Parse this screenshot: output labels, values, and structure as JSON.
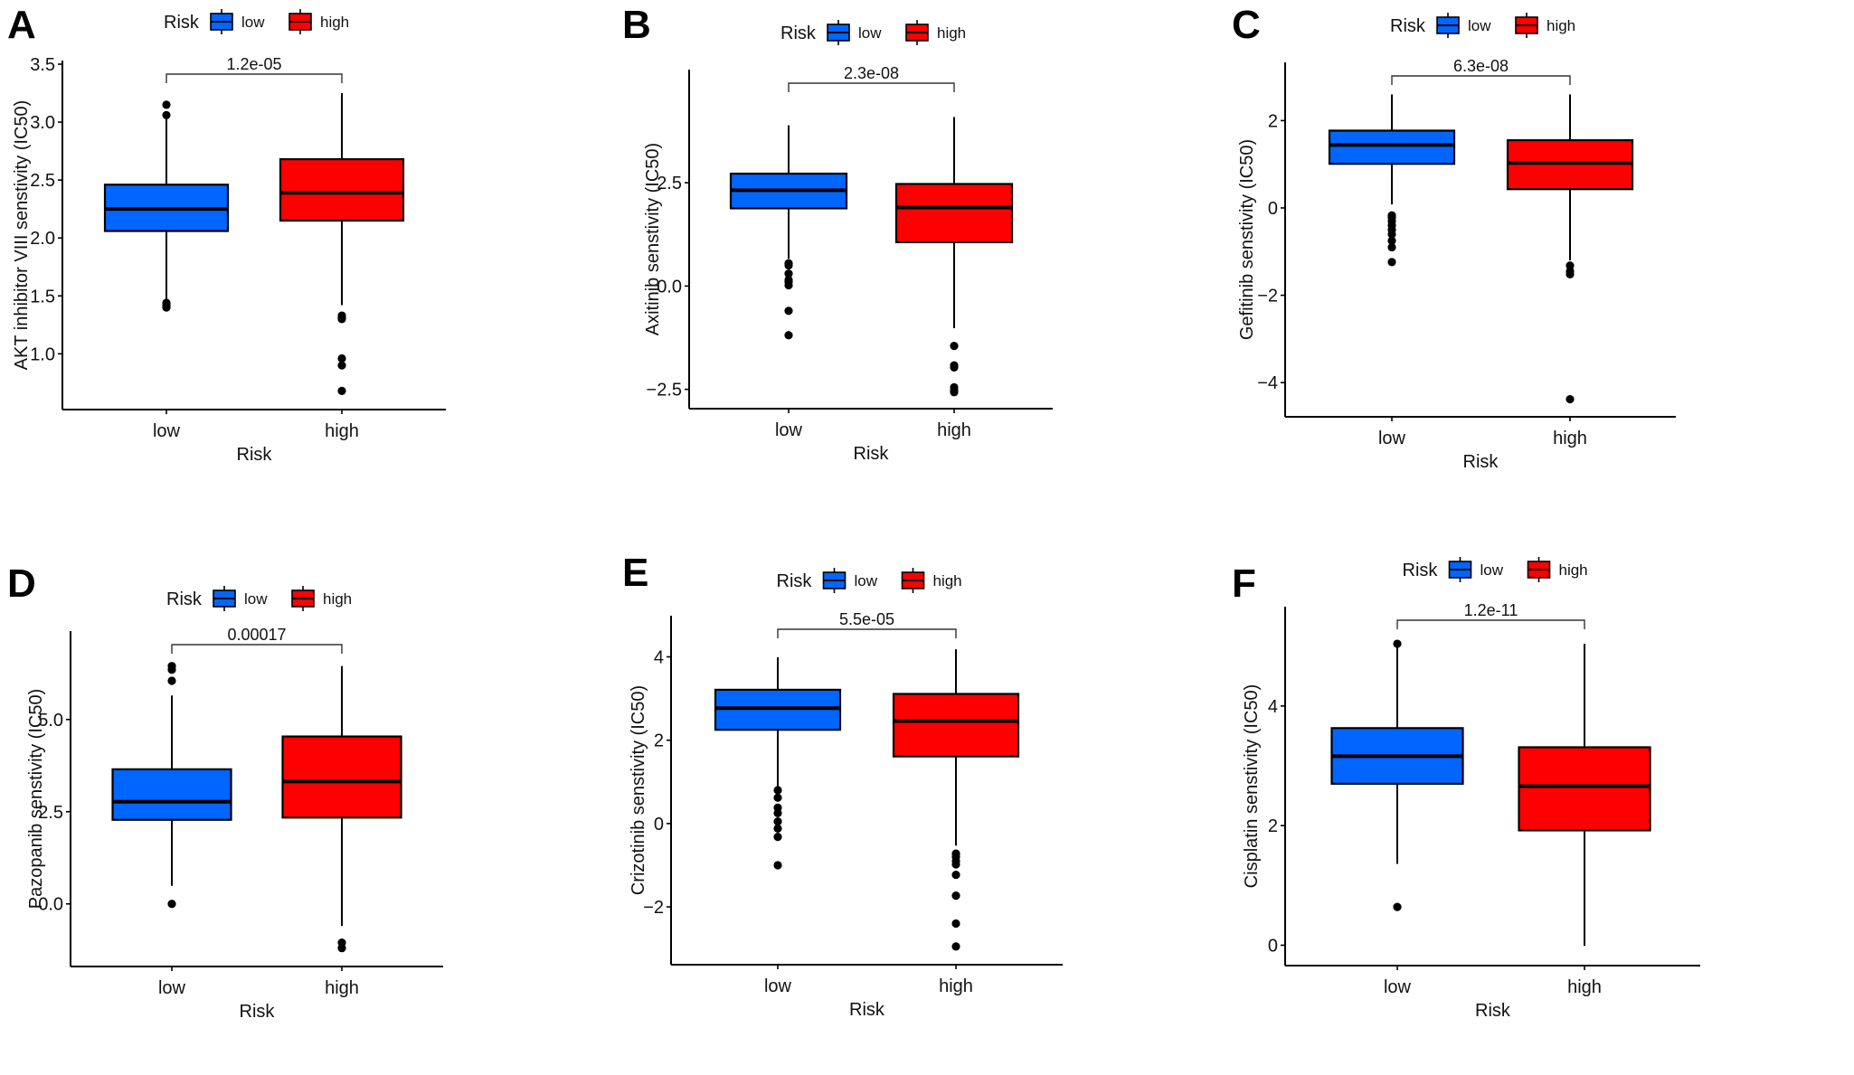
{
  "figure": {
    "colors": {
      "low": "#0066FF",
      "high": "#FF0000",
      "axis": "#000000"
    },
    "legend": {
      "title": "Risk",
      "items": [
        {
          "key": "low",
          "label": "low"
        },
        {
          "key": "high",
          "label": "high"
        }
      ]
    }
  },
  "chart_data": [
    {
      "panel": "A",
      "type": "boxplot",
      "title": "",
      "xlabel": "Risk",
      "ylabel": "AKT inhibitor VIII senstivity (IC50)",
      "categories": [
        "low",
        "high"
      ],
      "yticks": [
        "1.0",
        "1.5",
        "2.0",
        "2.5",
        "3.0",
        "3.5"
      ],
      "ylim": [
        0.55,
        3.5
      ],
      "p_value": "1.2e-05",
      "legend_position": "top",
      "series": [
        {
          "name": "low",
          "min": 1.46,
          "q1": 2.06,
          "median": 2.25,
          "q3": 2.46,
          "max": 3.04,
          "outliers": [
            3.15,
            3.06,
            1.44,
            1.42,
            1.4
          ]
        },
        {
          "name": "high",
          "min": 1.42,
          "q1": 2.15,
          "median": 2.39,
          "q3": 2.68,
          "max": 3.25,
          "outliers": [
            1.33,
            1.31,
            1.3,
            0.96,
            0.9,
            0.68
          ]
        }
      ]
    },
    {
      "panel": "B",
      "type": "boxplot",
      "title": "",
      "xlabel": "Risk",
      "ylabel": "Axitinib senstivity (IC50)",
      "categories": [
        "low",
        "high"
      ],
      "yticks": [
        "-2.5",
        "0.0",
        "2.5"
      ],
      "ylim": [
        -2.88,
        5.15
      ],
      "p_value": "2.3e-08",
      "legend_position": "top",
      "series": [
        {
          "name": "low",
          "min": 0.66,
          "q1": 1.88,
          "median": 2.32,
          "q3": 2.72,
          "max": 3.89,
          "outliers": [
            0.55,
            0.5,
            0.3,
            0.15,
            0.1,
            0.02,
            -0.6,
            -1.19
          ]
        },
        {
          "name": "high",
          "min": -1.02,
          "q1": 1.06,
          "median": 1.9,
          "q3": 2.47,
          "max": 4.09,
          "outliers": [
            -1.45,
            -1.92,
            -1.97,
            -2.45,
            -2.52,
            -2.57
          ]
        }
      ]
    },
    {
      "panel": "C",
      "type": "boxplot",
      "title": "",
      "xlabel": "Risk",
      "ylabel": "Gefitinib senstivity (IC50)",
      "categories": [
        "low",
        "high"
      ],
      "yticks": [
        "-4",
        "-2",
        "0",
        "2"
      ],
      "ylim": [
        -4.7,
        3.25
      ],
      "p_value": "6.3e-08",
      "legend_position": "top",
      "series": [
        {
          "name": "low",
          "min": 0.08,
          "q1": 1.01,
          "median": 1.44,
          "q3": 1.77,
          "max": 2.6,
          "outliers": [
            -0.17,
            -0.22,
            -0.3,
            -0.4,
            -0.5,
            -0.6,
            -0.75,
            -0.9,
            -1.24
          ]
        },
        {
          "name": "high",
          "min": -1.2,
          "q1": 0.43,
          "median": 1.03,
          "q3": 1.55,
          "max": 2.6,
          "outliers": [
            -1.32,
            -1.45,
            -1.52,
            -4.38
          ]
        }
      ]
    },
    {
      "panel": "D",
      "type": "boxplot",
      "title": "",
      "xlabel": "Risk",
      "ylabel": "Pazopanib senstivity (IC50)",
      "categories": [
        "low",
        "high"
      ],
      "yticks": [
        "0.0",
        "2.5",
        "5.0"
      ],
      "ylim": [
        -1.6,
        7.3
      ],
      "p_value": "0.00017",
      "legend_position": "top",
      "series": [
        {
          "name": "low",
          "min": 0.49,
          "q1": 2.28,
          "median": 2.77,
          "q3": 3.65,
          "max": 5.65,
          "outliers": [
            6.45,
            6.35,
            6.05,
            0.0
          ]
        },
        {
          "name": "high",
          "min": -0.6,
          "q1": 2.34,
          "median": 3.32,
          "q3": 4.54,
          "max": 6.45,
          "outliers": [
            -1.05,
            -1.2
          ]
        }
      ]
    },
    {
      "panel": "E",
      "type": "boxplot",
      "title": "",
      "xlabel": "Risk",
      "ylabel": "Crizotinib senstivity (IC50)",
      "categories": [
        "low",
        "high"
      ],
      "yticks": [
        "-2",
        "0",
        "2",
        "4"
      ],
      "ylim": [
        -3.3,
        4.9
      ],
      "p_value": "5.5e-05",
      "legend_position": "top",
      "series": [
        {
          "name": "low",
          "min": 0.8,
          "q1": 2.25,
          "median": 2.77,
          "q3": 3.21,
          "max": 3.99,
          "outliers": [
            0.8,
            0.62,
            0.38,
            0.25,
            0.05,
            -0.12,
            -0.32,
            -1.0
          ]
        },
        {
          "name": "high",
          "min": -0.53,
          "q1": 1.61,
          "median": 2.46,
          "q3": 3.11,
          "max": 4.18,
          "outliers": [
            -0.72,
            -0.8,
            -0.9,
            -0.98,
            -1.23,
            -1.73,
            -2.4,
            -2.95
          ]
        }
      ]
    },
    {
      "panel": "F",
      "type": "boxplot",
      "title": "",
      "xlabel": "Risk",
      "ylabel": "Cisplatin senstivity (IC50)",
      "categories": [
        "low",
        "high"
      ],
      "yticks": [
        "0",
        "2",
        "4"
      ],
      "ylim": [
        -0.28,
        5.6
      ],
      "p_value": "1.2e-11",
      "legend_position": "top",
      "series": [
        {
          "name": "low",
          "min": 1.36,
          "q1": 2.7,
          "median": 3.16,
          "q3": 3.63,
          "max": 5.04,
          "outliers": [
            5.04,
            0.64
          ]
        },
        {
          "name": "high",
          "min": -0.01,
          "q1": 1.92,
          "median": 2.66,
          "q3": 3.31,
          "max": 5.04,
          "outliers": []
        }
      ]
    }
  ]
}
